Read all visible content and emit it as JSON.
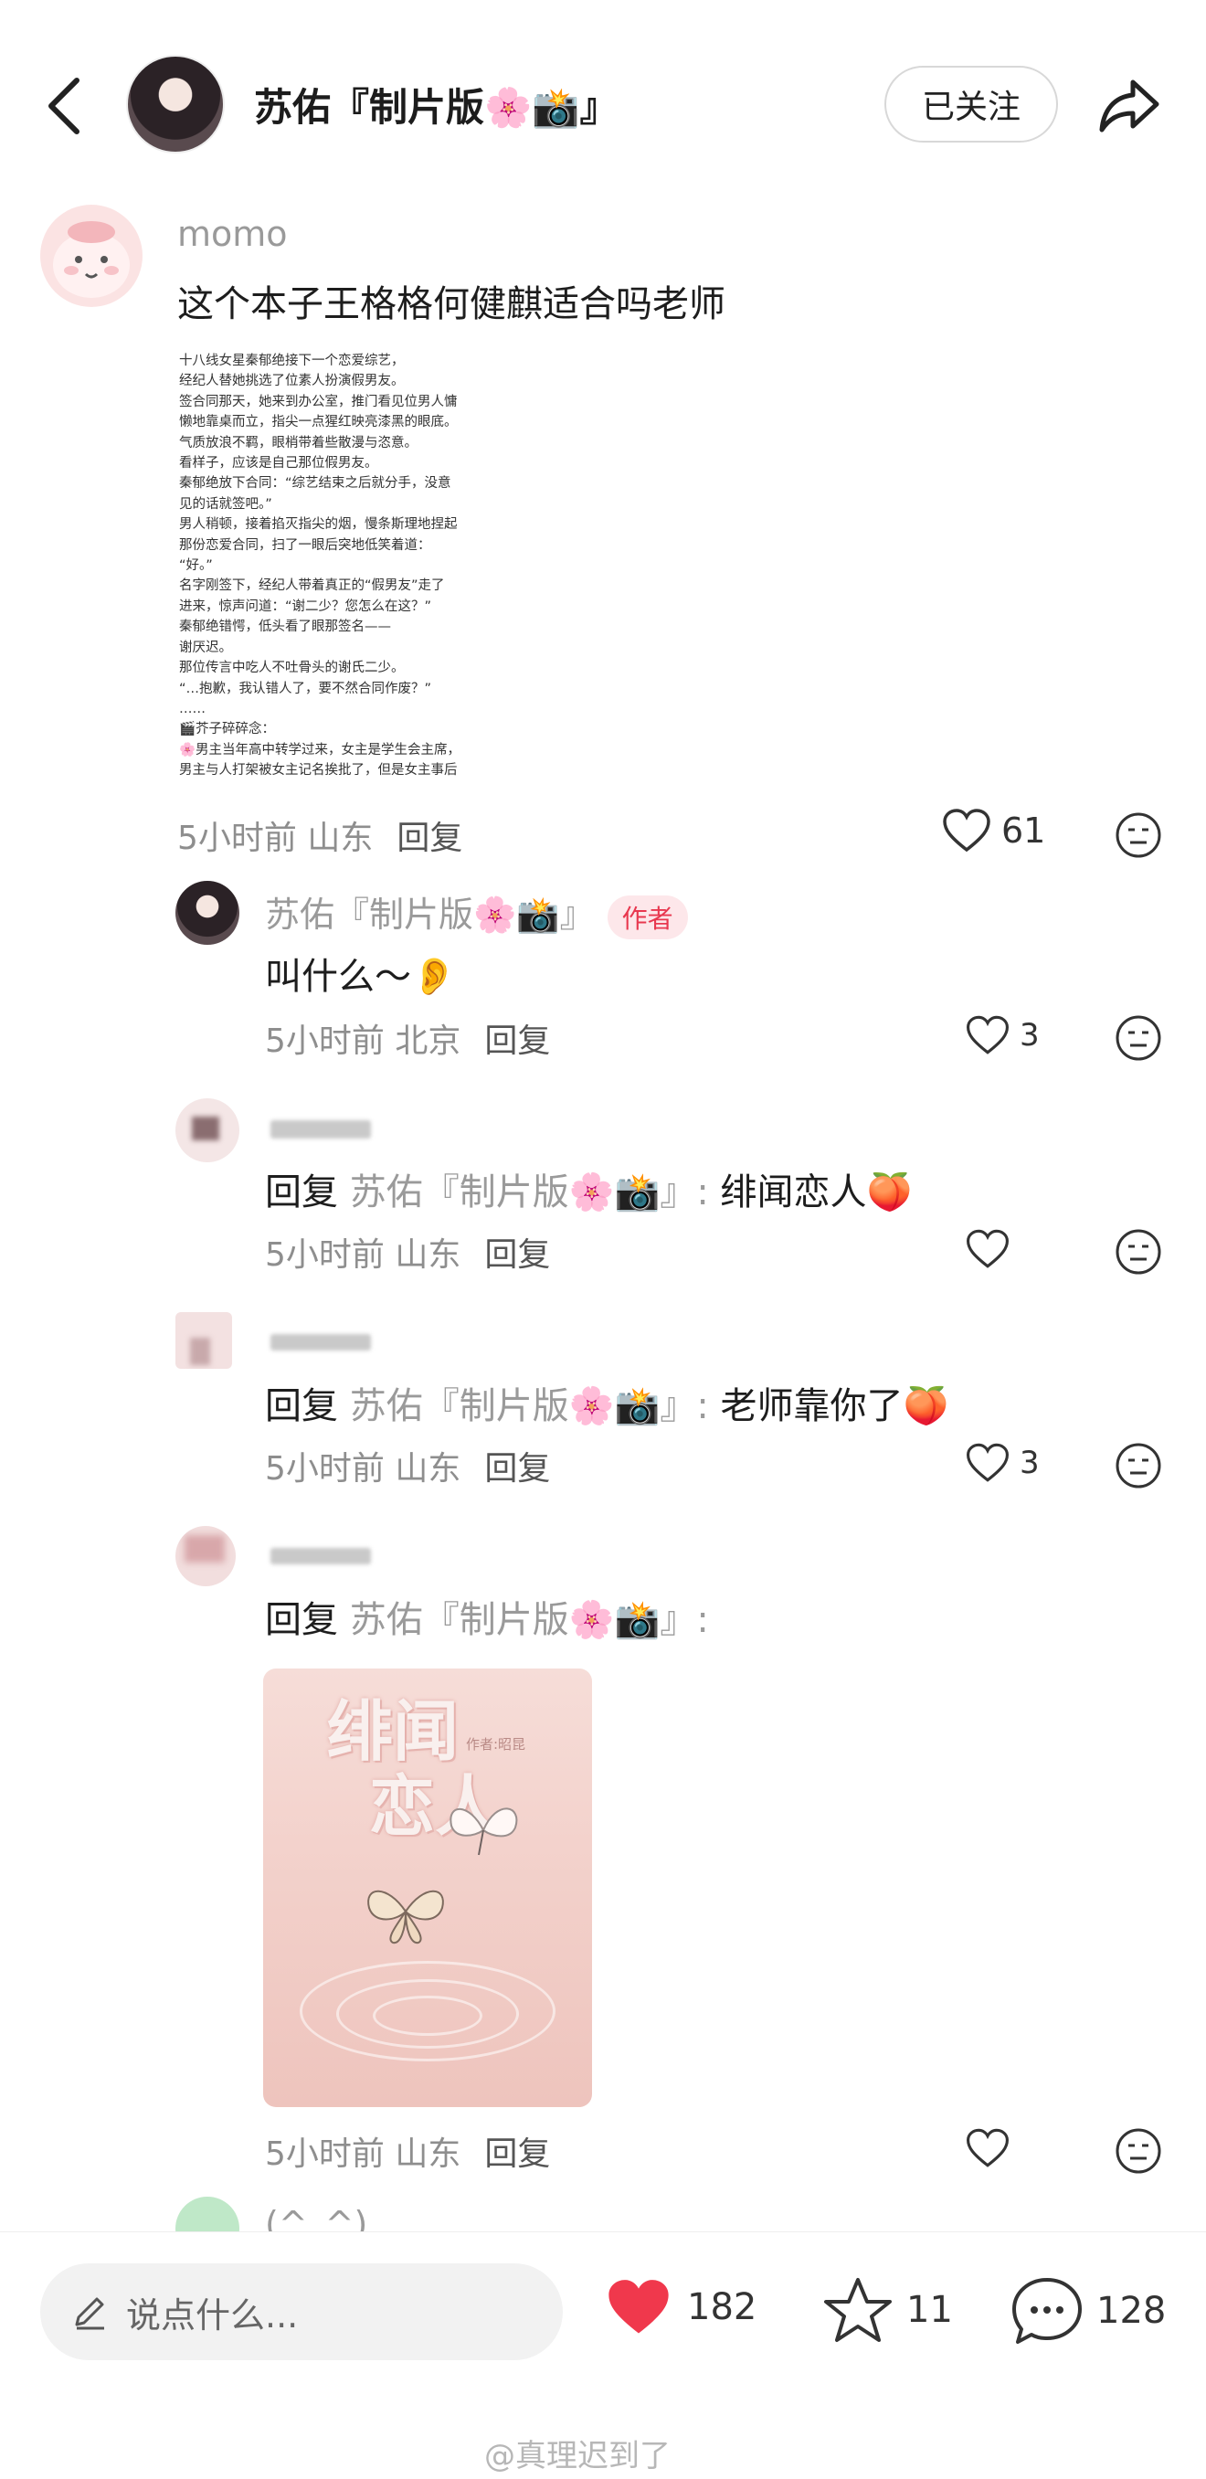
{
  "header": {
    "title": "苏佑『制片版🌸📸』",
    "follow_label": "已关注"
  },
  "main_comment": {
    "username": "momo",
    "text": "这个本子王格格何健麒适合吗老师",
    "screenshot_lines": [
      "十八线女星秦郁绝接下一个恋爱综艺，",
      "经纪人替她挑选了位素人扮演假男友。",
      "签合同那天，她来到办公室，推门看见位男人慵",
      "懒地靠桌而立，指尖一点猩红映亮漆黑的眼底。",
      "气质放浪不羁，眼梢带着些散漫与恣意。",
      "看样子，应该是自己那位假男友。",
      "秦郁绝放下合同：“综艺结束之后就分手，没意",
      "见的话就签吧。”",
      "男人稍顿，接着掐灭指尖的烟，慢条斯理地捏起",
      "那份恋爱合同，扫了一眼后突地低笑着道：",
      "“好。”",
      "名字刚签下，经纪人带着真正的“假男友”走了",
      "进来，惊声问道：“谢二少？您怎么在这？”",
      "秦郁绝错愕，低头看了眼那签名——",
      "谢厌迟。",
      "那位传言中吃人不吐骨头的谢氏二少。",
      "“…抱歉，我认错人了，要不然合同作废？”",
      "……",
      "🎬芥子碎碎念：",
      "🌸男主当年高中转学过来，女主是学生会主席，",
      "男主与人打架被女主记名挨批了，但是女主事后"
    ],
    "time": "5小时前 山东",
    "reply_label": "回复",
    "likes": "61"
  },
  "replies": [
    {
      "username": "苏佑『制片版🌸📸』",
      "author_tag": "作者",
      "text": "叫什么～👂",
      "time": "5小时前 北京",
      "reply_label": "回复",
      "likes": "3"
    },
    {
      "prefix": "回复",
      "target": "苏佑『制片版🌸📸』:",
      "text": "绯闻恋人🍑",
      "time": "5小时前 山东",
      "reply_label": "回复",
      "likes": ""
    },
    {
      "prefix": "回复",
      "target": "苏佑『制片版🌸📸』:",
      "text": "老师靠你了🍑",
      "time": "5小时前 山东",
      "reply_label": "回复",
      "likes": "3"
    },
    {
      "prefix": "回复",
      "target": "苏佑『制片版🌸📸』:",
      "text": "",
      "cover_title_1": "绯闻",
      "cover_title_2": "恋人",
      "cover_author": "作者:昭昆",
      "time": "5小时前 山东",
      "reply_label": "回复",
      "likes": ""
    }
  ],
  "partial_username": "(^_^)",
  "bottom_bar": {
    "input_placeholder": "说点什么...",
    "likes": "182",
    "stars": "11",
    "comments": "128"
  },
  "watermark": "@真理迟到了",
  "colors": {
    "like_red": "#f0384c",
    "author_tag": "#e8384f"
  },
  "icons": [
    "back-icon",
    "share-icon",
    "heart-icon",
    "dislike-face-icon",
    "pencil-icon",
    "star-icon",
    "comment-bubble-icon"
  ]
}
